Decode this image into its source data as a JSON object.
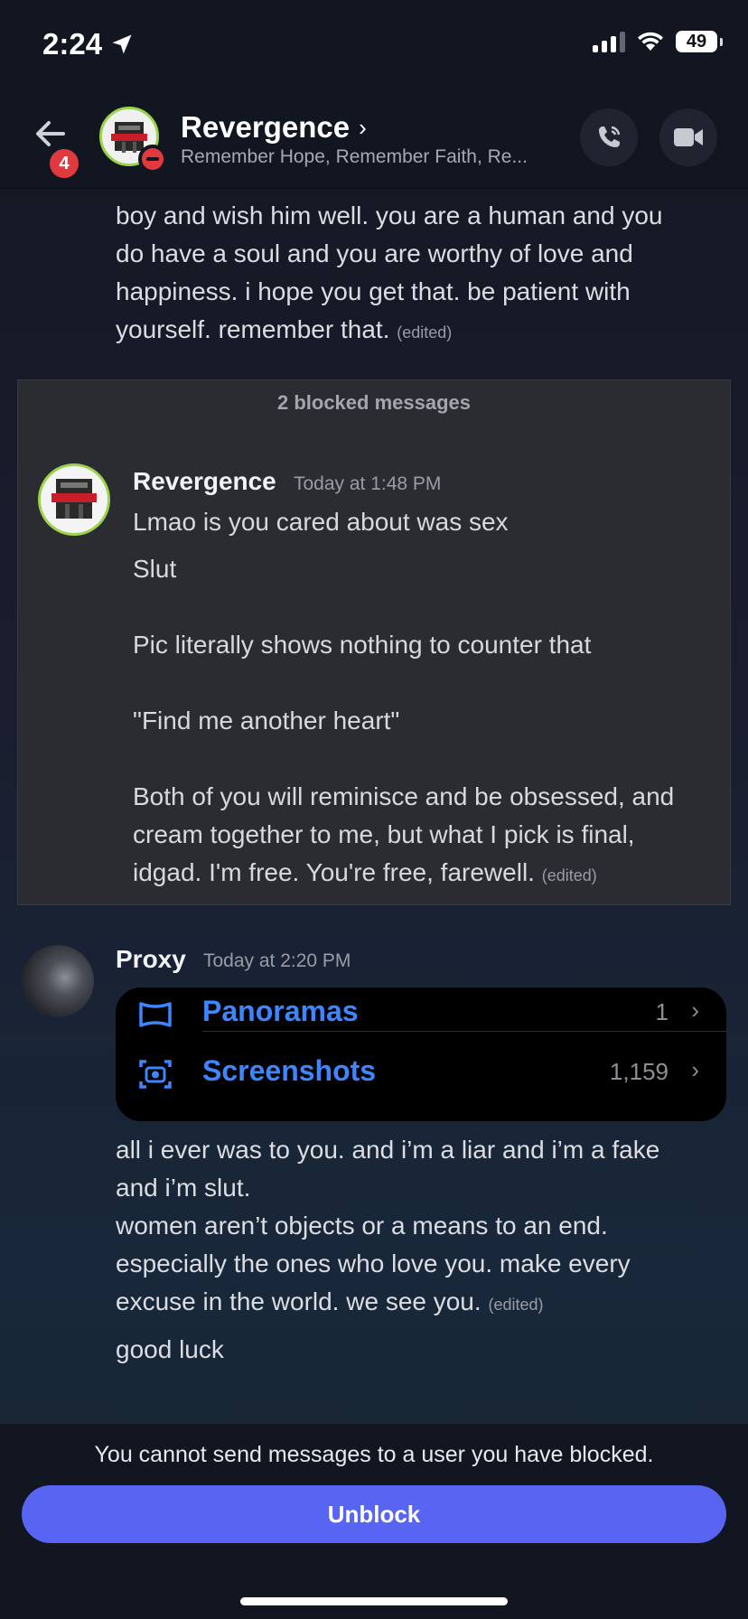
{
  "status_bar": {
    "time": "2:24",
    "battery": "49"
  },
  "header": {
    "back_badge": "4",
    "title": "Revergence",
    "subtitle": "Remember Hope, Remember Faith, Re..."
  },
  "previous_message": {
    "lines": [
      "boy and wish him well. you are a human and you",
      "do have a soul and you are worthy of love and",
      "happiness. i hope you get that. be patient with",
      "yourself. remember that."
    ],
    "edited": "(edited)"
  },
  "blocked": {
    "title": "2 blocked messages",
    "author": "Revergence",
    "timestamp": "Today at 1:48 PM",
    "line1": "Lmao is you cared about was sex",
    "line2": "Slut",
    "line3": "Pic literally shows nothing to counter that",
    "line4": "\"Find me another heart\"",
    "line5a": "Both of you will reminisce and be obsessed, and",
    "line5b": "cream together to me, but what I pick is final,",
    "line5c": "idgad. I'm free. You're free, farewell.",
    "edited": "(edited)"
  },
  "proxy": {
    "author": "Proxy",
    "timestamp": "Today at 2:20 PM",
    "attachment": {
      "rows": [
        {
          "label": "Panoramas",
          "count": "1",
          "icon": "panorama-icon"
        },
        {
          "label": "Screenshots",
          "count": "1,159",
          "icon": "screenshot-icon"
        }
      ]
    },
    "l1": "all i ever was to you. and i’m a liar and i’m a fake",
    "l2": "and i’m slut.",
    "l3": "women aren’t objects or a means to an end.",
    "l4": "especially the ones who love you. make every",
    "l5": "excuse in the world. we see you.",
    "edited": "(edited)",
    "followup": "good luck"
  },
  "footer": {
    "note": "You cannot send messages to a user you have blocked.",
    "button": "Unblock"
  },
  "colors": {
    "accent": "#5865f2",
    "badge": "#e03a3e",
    "online_ring": "#9bd34a",
    "link_blue": "#3d86ff"
  }
}
